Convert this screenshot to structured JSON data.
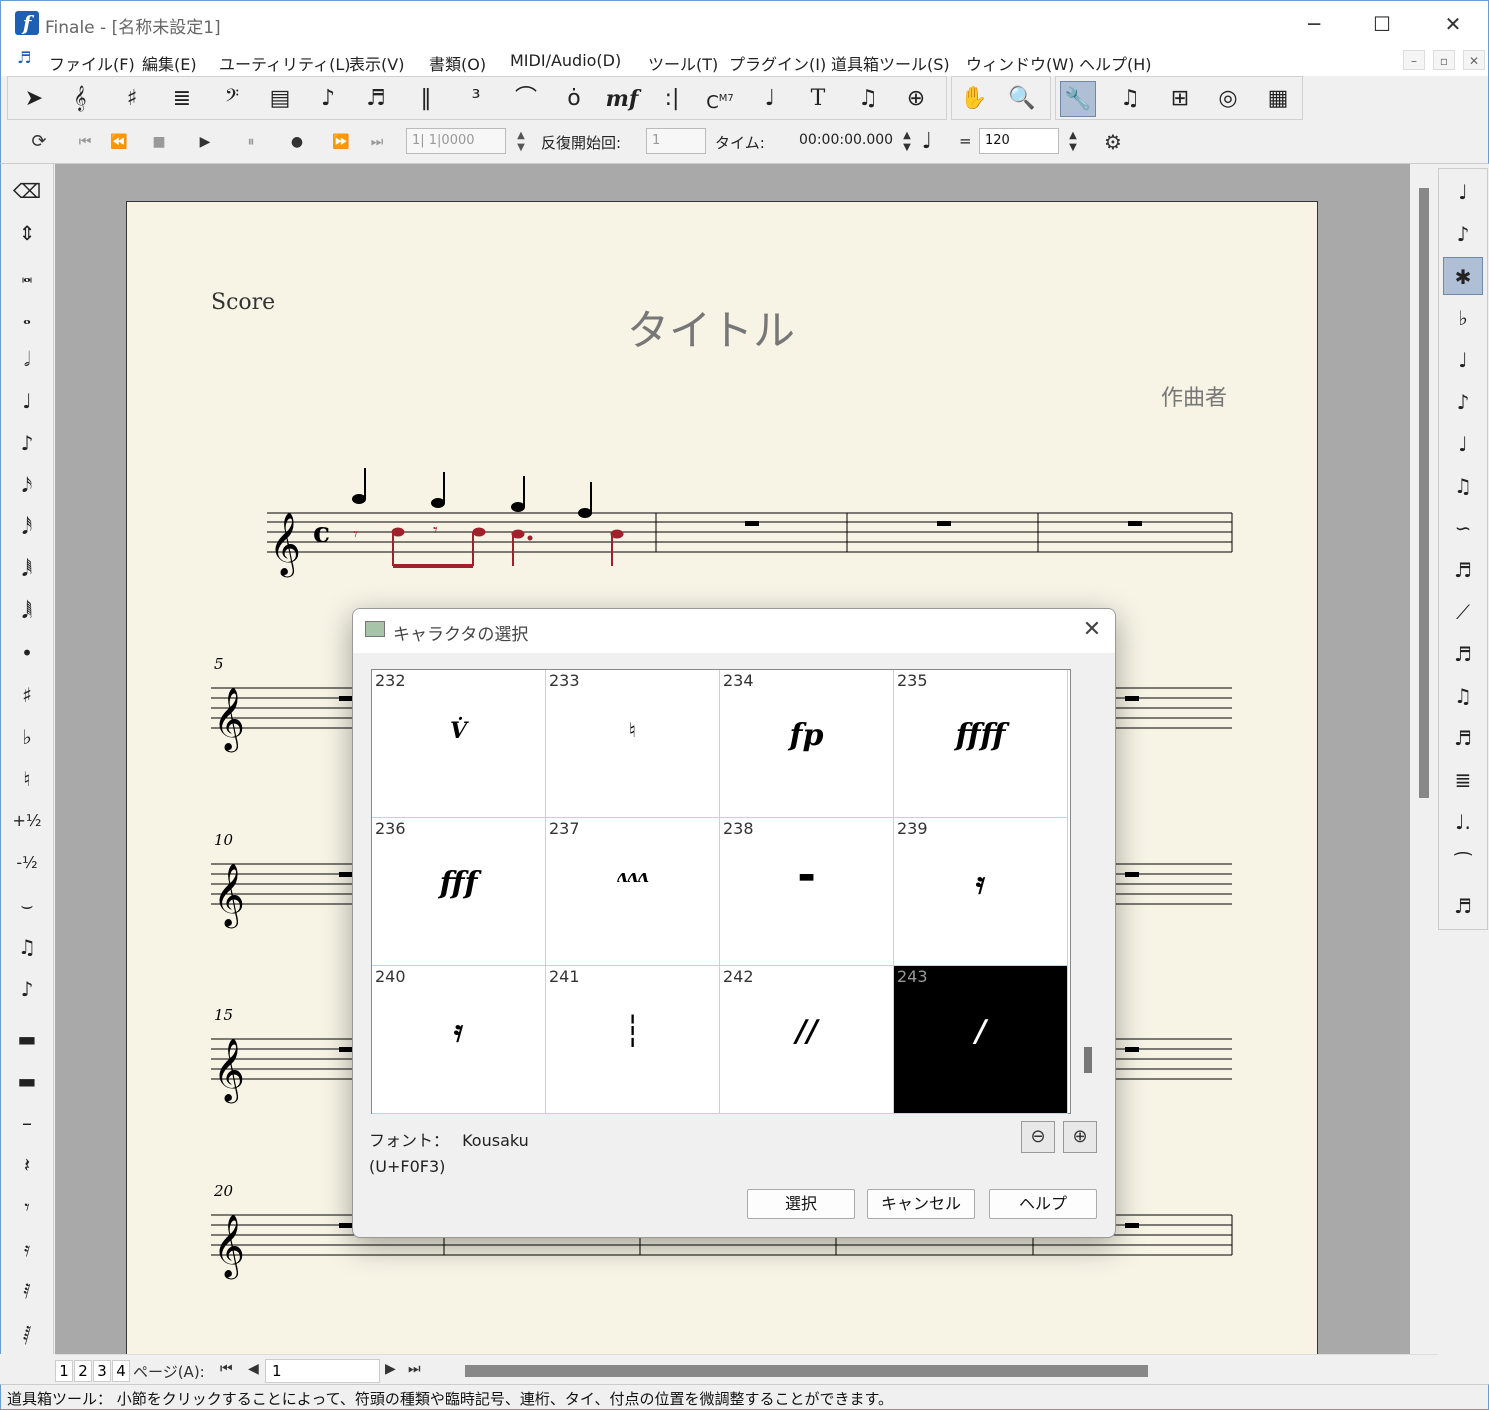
{
  "window": {
    "title": "Finale - [名称未設定1]",
    "logo_letter": "f",
    "minimize": "─",
    "maximize": "☐",
    "close": "✕"
  },
  "menu": {
    "items": [
      "ファイル(F)",
      "編集(E)",
      "ユーティリティ(L)",
      "表示(V)",
      "書類(O)",
      "MIDI/Audio(D)",
      "ツール(T)",
      "プラグイン(I)",
      "道具箱ツール(S)",
      "ウィンドウ(W)",
      "ヘルプ(H)"
    ],
    "mdi_min": "–",
    "mdi_restore": "▫",
    "mdi_close": "✕"
  },
  "main_tools": {
    "chord_label": "C",
    "chord_suffix": "M7",
    "text_tool": "T",
    "dynamic": "mf"
  },
  "playback": {
    "position": "1| 1|0000",
    "repeat_label": "反復開始回:",
    "repeat_value": "1",
    "time_label": "タイム:",
    "time_value": "00:00:00.000",
    "equals": "=",
    "tempo": "120"
  },
  "score": {
    "staff_label": "Score",
    "title": "タイトル",
    "composer": "作曲者",
    "measure_numbers": [
      "5",
      "10",
      "15",
      "20"
    ]
  },
  "left_palette": {
    "plus_half": "+½",
    "minus_half": "-½"
  },
  "page_bar": {
    "tabs": [
      "1",
      "2",
      "3",
      "4"
    ],
    "label": "ページ(A):",
    "value": "1"
  },
  "status": {
    "text": "道具箱ツール： 小節をクリックすることによって、符頭の種類や臨時記号、連桁、タイ、付点の位置を微調整することができます。"
  },
  "dialog": {
    "title": "キャラクタの選択",
    "cells": [
      {
        "code": "232",
        "glyph": "V̇"
      },
      {
        "code": "233",
        "glyph": "♮"
      },
      {
        "code": "234",
        "glyph": "fp"
      },
      {
        "code": "235",
        "glyph": "ffff"
      },
      {
        "code": "236",
        "glyph": "fff"
      },
      {
        "code": "237",
        "glyph": "ʌʌʌ"
      },
      {
        "code": "238",
        "glyph": "▬"
      },
      {
        "code": "239",
        "glyph": "𝄿"
      },
      {
        "code": "240",
        "glyph": "𝄿"
      },
      {
        "code": "241",
        "glyph": "┆"
      },
      {
        "code": "242",
        "glyph": "//"
      },
      {
        "code": "243",
        "glyph": "/"
      }
    ],
    "selected_code": "243",
    "font_label": "フォント：",
    "font_name": "Kousaku",
    "unicode": "(U+F0F3)",
    "select_button": "選択",
    "cancel_button": "キャンセル",
    "help_button": "ヘルプ"
  },
  "colors": {
    "accent": "#1e5fb4",
    "selected_tool": "#aebfd6",
    "entered_notes": "#a0202c",
    "paper": "#f7f4e6"
  }
}
